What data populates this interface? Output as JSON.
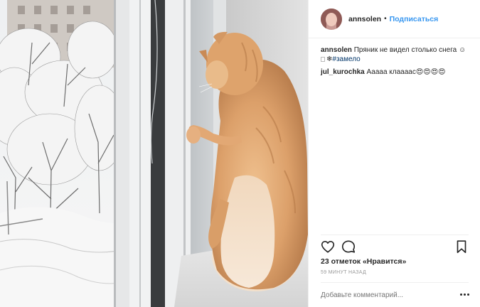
{
  "post": {
    "photo_alt": "",
    "header": {
      "username": "annsolen",
      "separator": "•",
      "follow_label": "Подписаться"
    },
    "comments": [
      {
        "username": "annsolen",
        "text": "Пряник не видел столько снега",
        "emoji": "☺",
        "hashtag_prefix": "❄",
        "hashtag": "#замело"
      },
      {
        "username": "jul_kurochka",
        "text": "Ааааа клаааас",
        "emoji": "😍😍😍😍"
      }
    ],
    "actions": {
      "like_icon": "heart-icon",
      "comment_icon": "comment-bubble-icon",
      "save_icon": "bookmark-icon"
    },
    "likes_text": "23 отметок «Нравится»",
    "time_text": "59 минут назад",
    "add_comment_placeholder": "Добавьте комментарий...",
    "more_icon": "more-dots-icon",
    "colors": {
      "link_blue": "#3897f0",
      "text": "#262626",
      "muted": "#999999",
      "divider": "#efefef"
    }
  }
}
